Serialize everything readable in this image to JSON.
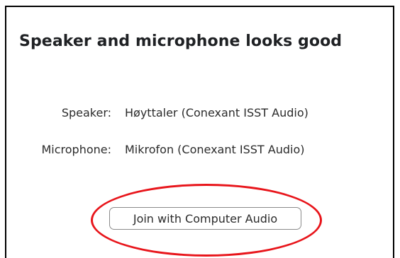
{
  "dialog": {
    "title": "Speaker and microphone looks good",
    "speaker": {
      "label": "Speaker:",
      "value": "Høyttaler (Conexant ISST Audio)"
    },
    "microphone": {
      "label": "Microphone:",
      "value": "Mikrofon (Conexant ISST Audio)"
    },
    "join_button_label": "Join with Computer Audio"
  },
  "colors": {
    "highlight": "#e8151b",
    "border": "#000000",
    "button_border": "#8a8a8a"
  }
}
